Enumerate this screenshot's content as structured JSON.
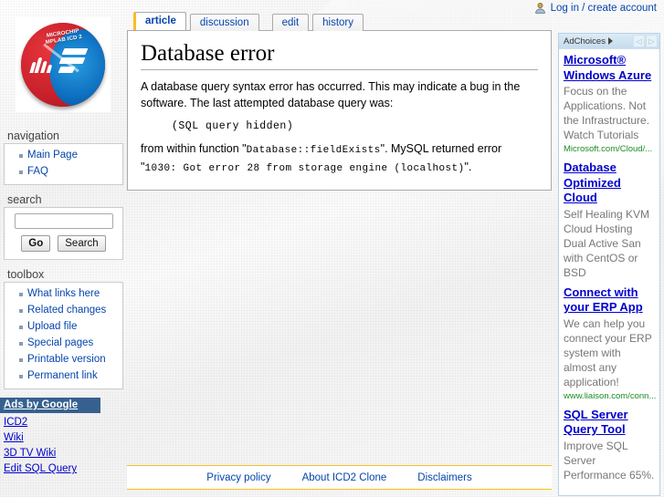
{
  "personal": {
    "icon": "user-icon",
    "login_label": "Log in / create account"
  },
  "logo": {
    "disc_top_text": "MICROCHIP MPLAB ICD 2",
    "alt": "ICD2 Clone site logo"
  },
  "sidebar": {
    "navigation": {
      "heading": "navigation",
      "items": [
        {
          "label": "Main Page"
        },
        {
          "label": "FAQ"
        }
      ]
    },
    "search": {
      "heading": "search",
      "value": "",
      "placeholder": "",
      "go_label": "Go",
      "search_label": "Search"
    },
    "toolbox": {
      "heading": "toolbox",
      "items": [
        {
          "label": "What links here"
        },
        {
          "label": "Related changes"
        },
        {
          "label": "Upload file"
        },
        {
          "label": "Special pages"
        },
        {
          "label": "Printable version"
        },
        {
          "label": "Permanent link"
        }
      ]
    },
    "ads": {
      "heading": "Ads by Google",
      "items": [
        {
          "label": "ICD2"
        },
        {
          "label": "Wiki"
        },
        {
          "label": "3D TV Wiki"
        },
        {
          "label": "Edit SQL Query"
        }
      ]
    }
  },
  "tabs": [
    {
      "label": "article",
      "selected": true
    },
    {
      "label": "discussion",
      "selected": false
    },
    {
      "label": "edit",
      "selected": false
    },
    {
      "label": "history",
      "selected": false
    }
  ],
  "content": {
    "heading": "Database error",
    "paragraph_1": "A database query syntax error has occurred. This may indicate a bug in the software. The last attempted database query was:",
    "sql_block": "(SQL query hidden)",
    "error_prefix": "from within function \"",
    "error_function": "Database::fieldExists",
    "error_middle": "\". MySQL returned error \"",
    "error_code": "1030: Got error 28 from storage engine (localhost)",
    "error_suffix": "\"."
  },
  "ad_column": {
    "adchoices_label": "AdChoices",
    "prev_arrow": "◁",
    "next_arrow": "▷",
    "ads": [
      {
        "title": "Microsoft® Windows Azure",
        "desc": "Focus on the Applications. Not the Infrastructure. Watch Tutorials",
        "url": "Microsoft.com/Cloud/..."
      },
      {
        "title": "Database Optimized Cloud",
        "desc": "Self Healing KVM Cloud Hosting Dual Active San with CentOS or BSD",
        "url": ""
      },
      {
        "title": "Connect with your ERP App",
        "desc": "We can help you connect your ERP system with almost any application!",
        "url": "www.liaison.com/conn..."
      },
      {
        "title": "SQL Server Query Tool",
        "desc": "Improve SQL Server Performance 65%.",
        "url": ""
      }
    ]
  },
  "footer": {
    "links": [
      {
        "label": "Privacy policy"
      },
      {
        "label": "About ICD2 Clone"
      },
      {
        "label": "Disclaimers"
      }
    ]
  },
  "colors": {
    "link": "#0645ad",
    "ad_link": "#0000cc",
    "ad_url": "#1a8c23",
    "footer_rule": "#fabd23",
    "ads_header_bg": "#36618f"
  }
}
